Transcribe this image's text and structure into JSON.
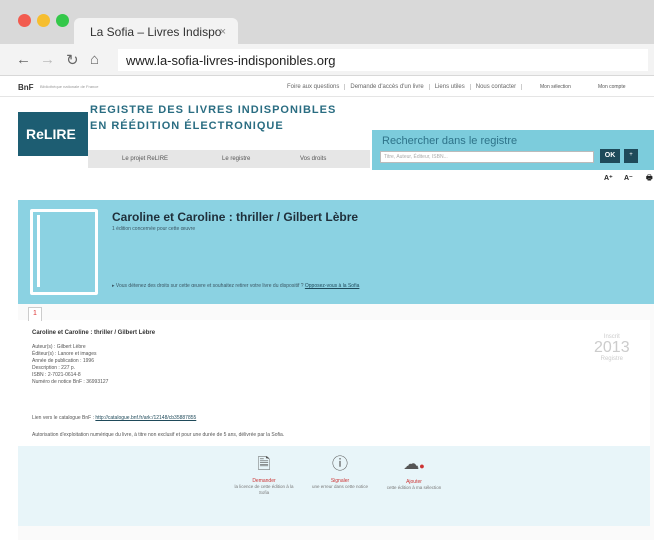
{
  "browser": {
    "tab_title": "La Sofia – Livres Indispo",
    "tab_close": "×",
    "url": "www.la-sofia-livres-indisponibles.org",
    "nav_icons": [
      "back-icon",
      "forward-icon",
      "reload-icon",
      "home-icon"
    ]
  },
  "site": {
    "bnf_logo": "BnF",
    "bnf_sub": "Bibliothèque nationale de France",
    "top_links": [
      "Foire aux questions",
      "Demande d'accès d'un livre",
      "Liens utiles",
      "Nous contacter"
    ],
    "account_links": [
      "Mon sélection",
      "Mon compte"
    ],
    "logo_text": "ReLIRE",
    "registry_title_line1": "REGISTRE DES LIVRES INDISPONIBLES",
    "registry_title_line2": "EN RÉÉDITION ÉLECTRONIQUE",
    "nav_items": [
      "Le projet ReLIRE",
      "Le registre",
      "Vos droits"
    ],
    "search": {
      "title": "Rechercher dans le registre",
      "placeholder": "Titre, Auteur, Éditeur, ISBN...",
      "ok_label": "OK",
      "advanced_label": "+"
    },
    "font_controls": [
      "A⁺",
      "A⁻",
      "🖶"
    ]
  },
  "record": {
    "title": "Caroline et Caroline : thriller / Gilbert Lèbre",
    "subtitle": "1 édition concernée pour cette œuvre",
    "notice": "Vous détenez des droits sur cette œuvre et souhaitez retirer votre livre du dispositif ?",
    "notice_link": "Opposez-vous à la Sofia",
    "tab_number": "1",
    "detail_title": "Caroline et Caroline : thriller / Gilbert Lèbre",
    "details": [
      "Auteur(s) : Gilbert Lèbre",
      "Éditeur(s) : Lanore et images",
      "Année de publication : 1996",
      "Description : 227 p.",
      "ISBN : 2-7021-0614-8",
      "Numéro de notice BnF : 36993127"
    ],
    "year_label": "Inscrit",
    "year": "2013",
    "year_sub": "Registre",
    "permalink_label": "Lien vers le catalogue BnF :",
    "permalink": "http://catalogue.bnf.fr/ark:/12148/cb35887855",
    "authorization": "Autorisation d'exploitation numérique du livre, à titre non exclusif et pour une durée de 5 ans, délivrée par la Sofia.",
    "actions": [
      {
        "icon": "download-doc-icon",
        "label": "Demander",
        "desc": "la licence de cette édition à la Sofia"
      },
      {
        "icon": "alert-icon",
        "label": "Signaler",
        "desc": "une erreur dans cette notice"
      },
      {
        "icon": "cloud-add-icon",
        "label": "Ajouter",
        "desc": "cette édition à ma sélection"
      }
    ]
  }
}
